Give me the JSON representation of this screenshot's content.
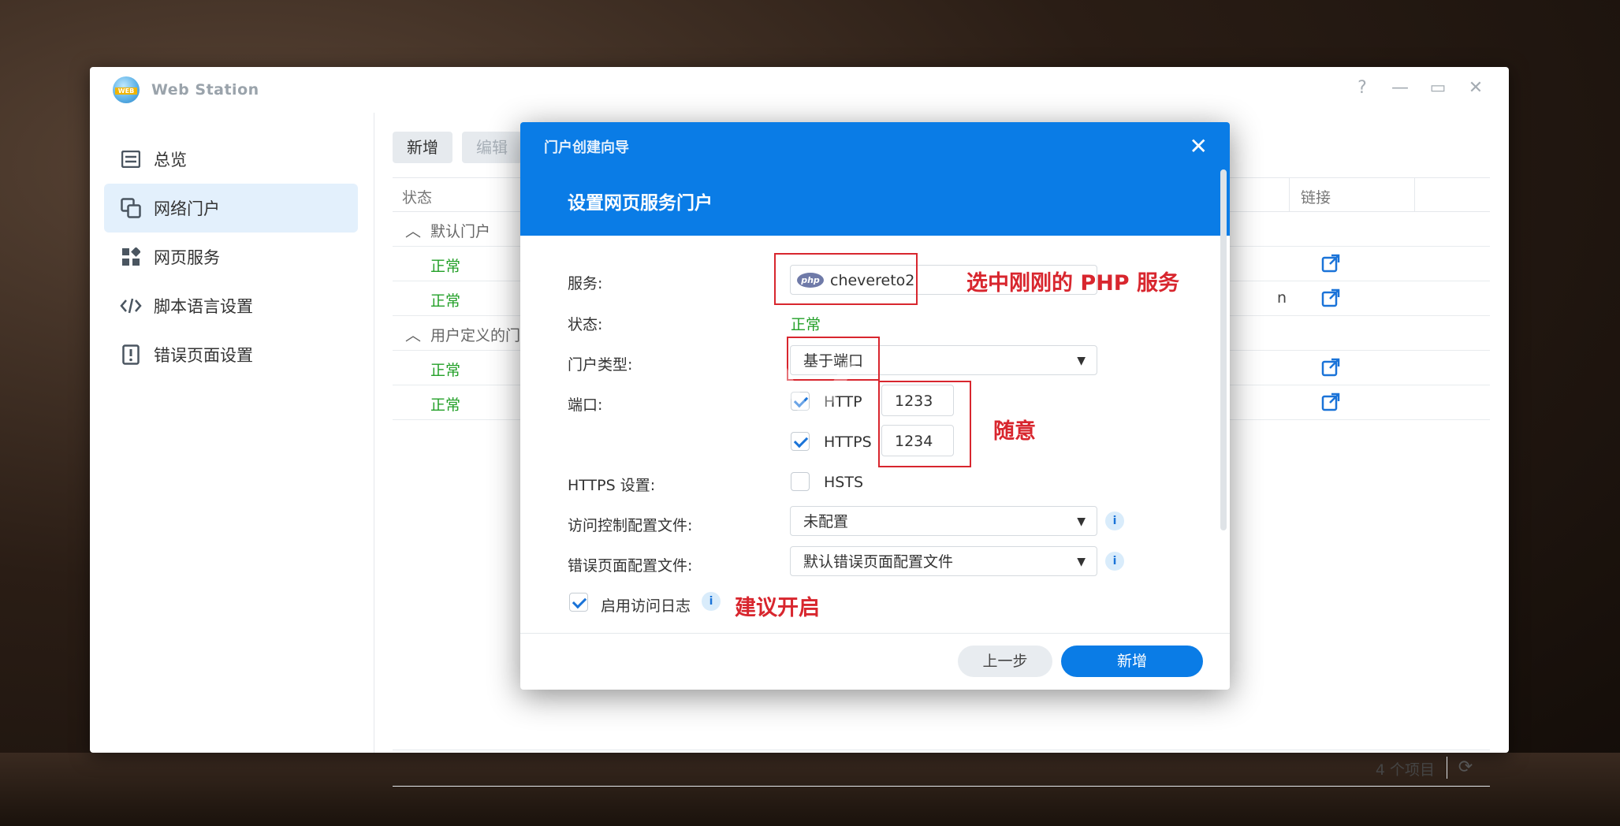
{
  "window": {
    "title": "Web Station",
    "controls": [
      "?",
      "—",
      "▭",
      "✕"
    ]
  },
  "sidebar": {
    "items": [
      {
        "label": "总览",
        "icon": "overview-icon"
      },
      {
        "label": "网络门户",
        "icon": "portal-icon",
        "active": true
      },
      {
        "label": "网页服务",
        "icon": "web-service-icon"
      },
      {
        "label": "脚本语言设置",
        "icon": "code-icon"
      },
      {
        "label": "错误页面设置",
        "icon": "error-page-icon"
      }
    ]
  },
  "toolbar": {
    "new_label": "新增",
    "edit_label": "编辑"
  },
  "grid": {
    "col_status": "状态",
    "col_link": "链接",
    "group_default": "默认门户",
    "group_custom": "用户定义的门户",
    "row_status": "正常",
    "row_n_suffix": "n",
    "count_label": "4 个项目"
  },
  "dialog": {
    "title": "门户创建向导",
    "subtitle": "设置网页服务门户",
    "service_label": "服务:",
    "service_value": "chevereto2",
    "service_badge": "php",
    "status_label": "状态:",
    "status_value": "正常",
    "portal_type_label": "门户类型:",
    "portal_type_value": "基于端口",
    "port_label": "端口:",
    "http_label": "HTTP",
    "http_port": "1233",
    "https_label": "HTTPS",
    "https_port": "1234",
    "https_settings_label": "HTTPS 设置:",
    "hsts_label": "HSTS",
    "access_control_label": "访问控制配置文件:",
    "access_control_value": "未配置",
    "error_page_label": "错误页面配置文件:",
    "error_page_value": "默认错误页面配置文件",
    "access_log_label": "启用访问日志",
    "prev_button": "上一步",
    "add_button": "新增",
    "close_glyph": "✕",
    "info_glyph": "i",
    "dropdown_glyph": "▼"
  },
  "annotations": {
    "service_note": "选中刚刚的 PHP 服务",
    "port_note": "随意",
    "log_note": "建议开启"
  },
  "colors": {
    "accent": "#0a7ce6",
    "ok": "#23a028",
    "annotation": "#d8262e"
  }
}
